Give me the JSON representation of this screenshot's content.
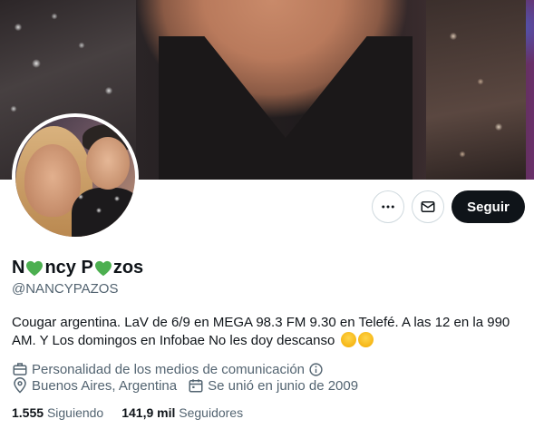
{
  "profile": {
    "name_part1": "N",
    "name_part2": "ncy P",
    "name_part3": "zos",
    "handle": "@NANCYPAZOS",
    "bio": "Cougar argentina. LaV de 6/9 en MEGA 98.3 FM 9.30 en Telefé. A las 12 en la 990 AM. Y Los domingos en Infobae No les doy descanso",
    "category": "Personalidad de los medios de comunicación",
    "location": "Buenos Aires, Argentina",
    "joined": "Se unió en junio de 2009",
    "following_count": "1.555",
    "following_label": "Siguiendo",
    "followers_count": "141,9 mil",
    "followers_label": "Seguidores"
  },
  "actions": {
    "follow_label": "Seguir"
  },
  "icons": {
    "name_emoji": "green-heart",
    "bio_emoji": "rolling-on-the-floor-laughing",
    "category": "briefcase-icon",
    "info": "info-icon",
    "location": "location-pin-icon",
    "joined": "calendar-icon",
    "more": "more-icon",
    "message": "envelope-icon"
  },
  "colors": {
    "primary_text": "#0f1419",
    "secondary_text": "#536471",
    "heart_green": "#4caf50",
    "button_bg": "#0f1419"
  }
}
